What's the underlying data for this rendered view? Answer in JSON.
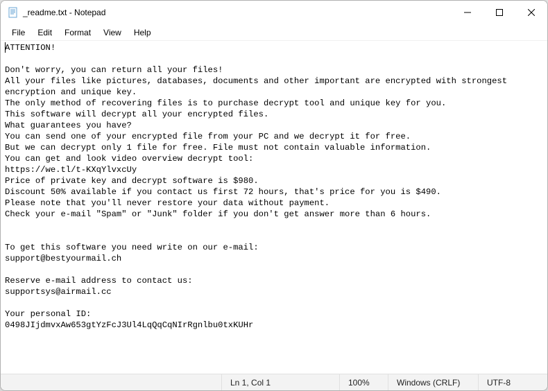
{
  "titlebar": {
    "title": "_readme.txt - Notepad"
  },
  "menu": {
    "file": "File",
    "edit": "Edit",
    "format": "Format",
    "view": "View",
    "help": "Help"
  },
  "content": {
    "text": "ATTENTION!\n\nDon't worry, you can return all your files!\nAll your files like pictures, databases, documents and other important are encrypted with strongest encryption and unique key.\nThe only method of recovering files is to purchase decrypt tool and unique key for you.\nThis software will decrypt all your encrypted files.\nWhat guarantees you have?\nYou can send one of your encrypted file from your PC and we decrypt it for free.\nBut we can decrypt only 1 file for free. File must not contain valuable information.\nYou can get and look video overview decrypt tool:\nhttps://we.tl/t-KXqYlvxcUy\nPrice of private key and decrypt software is $980.\nDiscount 50% available if you contact us first 72 hours, that's price for you is $490.\nPlease note that you'll never restore your data without payment.\nCheck your e-mail \"Spam\" or \"Junk\" folder if you don't get answer more than 6 hours.\n\n\nTo get this software you need write on our e-mail:\nsupport@bestyourmail.ch\n\nReserve e-mail address to contact us:\nsupportsys@airmail.cc\n\nYour personal ID:\n0498JIjdmvxAw653gtYzFcJ3Ul4LqQqCqNIrRgnlbu0txKUHr"
  },
  "statusbar": {
    "position": "Ln 1, Col 1",
    "zoom": "100%",
    "eol": "Windows (CRLF)",
    "encoding": "UTF-8"
  }
}
